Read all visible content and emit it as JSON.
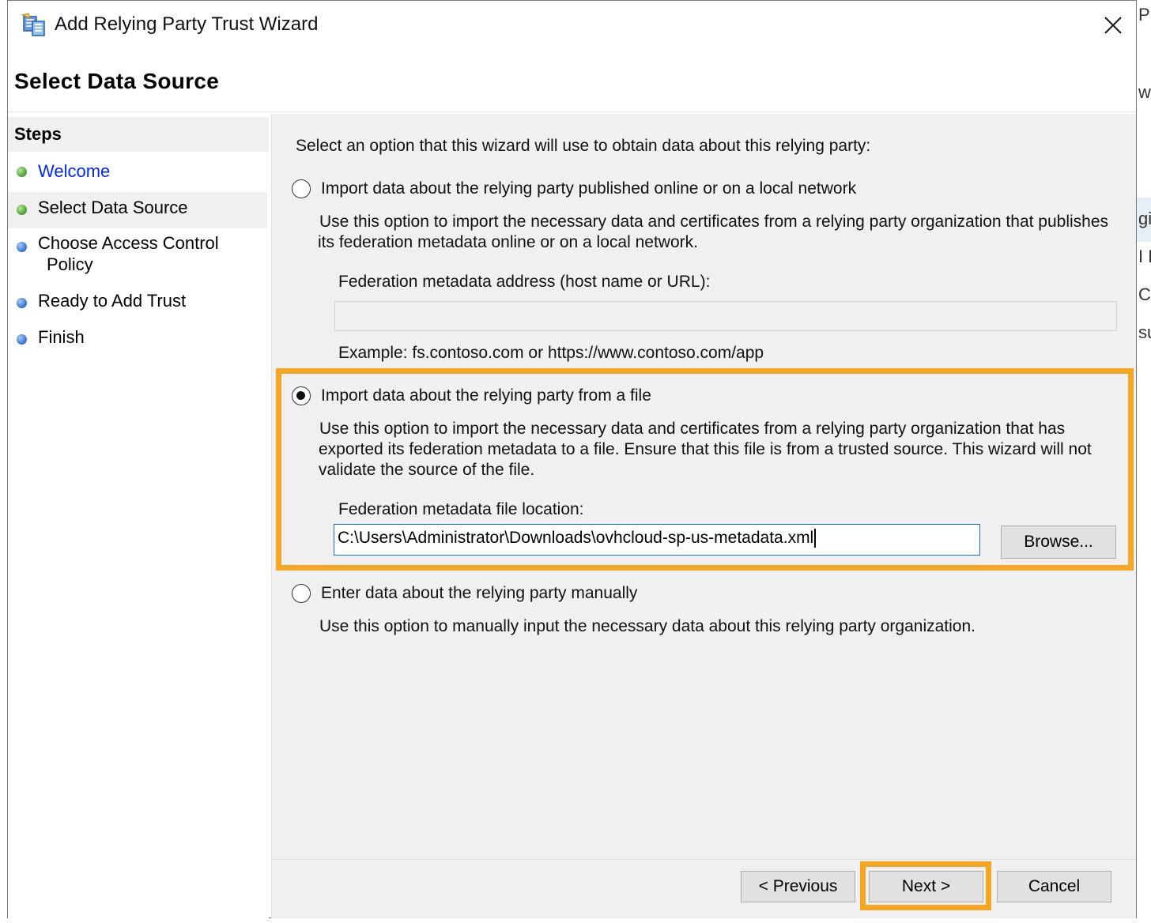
{
  "window": {
    "title": "Add Relying Party Trust Wizard",
    "page_heading": "Select Data Source"
  },
  "background_window": {
    "fragments": [
      "P",
      "w",
      "gi",
      "I F",
      "Co",
      "su"
    ]
  },
  "steps": {
    "header": "Steps",
    "items": [
      {
        "label": "Welcome",
        "status": "complete",
        "dot_color": "#43a02a"
      },
      {
        "label": "Select Data Source",
        "status": "current",
        "dot_color": "#43a02a"
      },
      {
        "label_line1": "Choose Access Control",
        "label_line2": "Policy",
        "status": "pending",
        "dot_color": "#2f6fcf"
      },
      {
        "label": "Ready to Add Trust",
        "status": "pending",
        "dot_color": "#2f6fcf"
      },
      {
        "label": "Finish",
        "status": "pending",
        "dot_color": "#2f6fcf"
      }
    ]
  },
  "content": {
    "intro": "Select an option that this wizard will use to obtain data about this relying party:",
    "option_online": {
      "label": "Import data about the relying party published online or on a local network",
      "selected": false,
      "desc_line1": "Use this option to import the necessary data and certificates from a relying party organization that publishes",
      "desc_line2": "its federation metadata online or on a local network.",
      "field_label": "Federation metadata address (host name or URL):",
      "field_value": "",
      "field_enabled": false,
      "example": "Example: fs.contoso.com or https://www.contoso.com/app"
    },
    "option_file": {
      "label": "Import data about the relying party from a file",
      "selected": true,
      "desc_line1": "Use this option to import the necessary data and certificates from a relying party organization that has",
      "desc_line2": "exported its federation metadata to a file. Ensure that this file is from a trusted source.  This wizard will not",
      "desc_line3": "validate the source of the file.",
      "field_label": "Federation metadata file location:",
      "field_value": "C:\\Users\\Administrator\\Downloads\\ovhcloud-sp-us-metadata.xml",
      "browse_label": "Browse..."
    },
    "option_manual": {
      "label": "Enter data about the relying party manually",
      "selected": false,
      "desc": "Use this option to manually input the necessary data about this relying party organization."
    }
  },
  "footer": {
    "previous_label": "< Previous",
    "next_label": "Next >",
    "cancel_label": "Cancel"
  },
  "colors": {
    "highlight": "#f5a623",
    "link": "#0026ff",
    "panel": "#f0f0f0",
    "focus_border": "#1a6fd6"
  },
  "icons": {
    "title_icon": "relying-party-trust-icon",
    "close": "close-icon"
  }
}
